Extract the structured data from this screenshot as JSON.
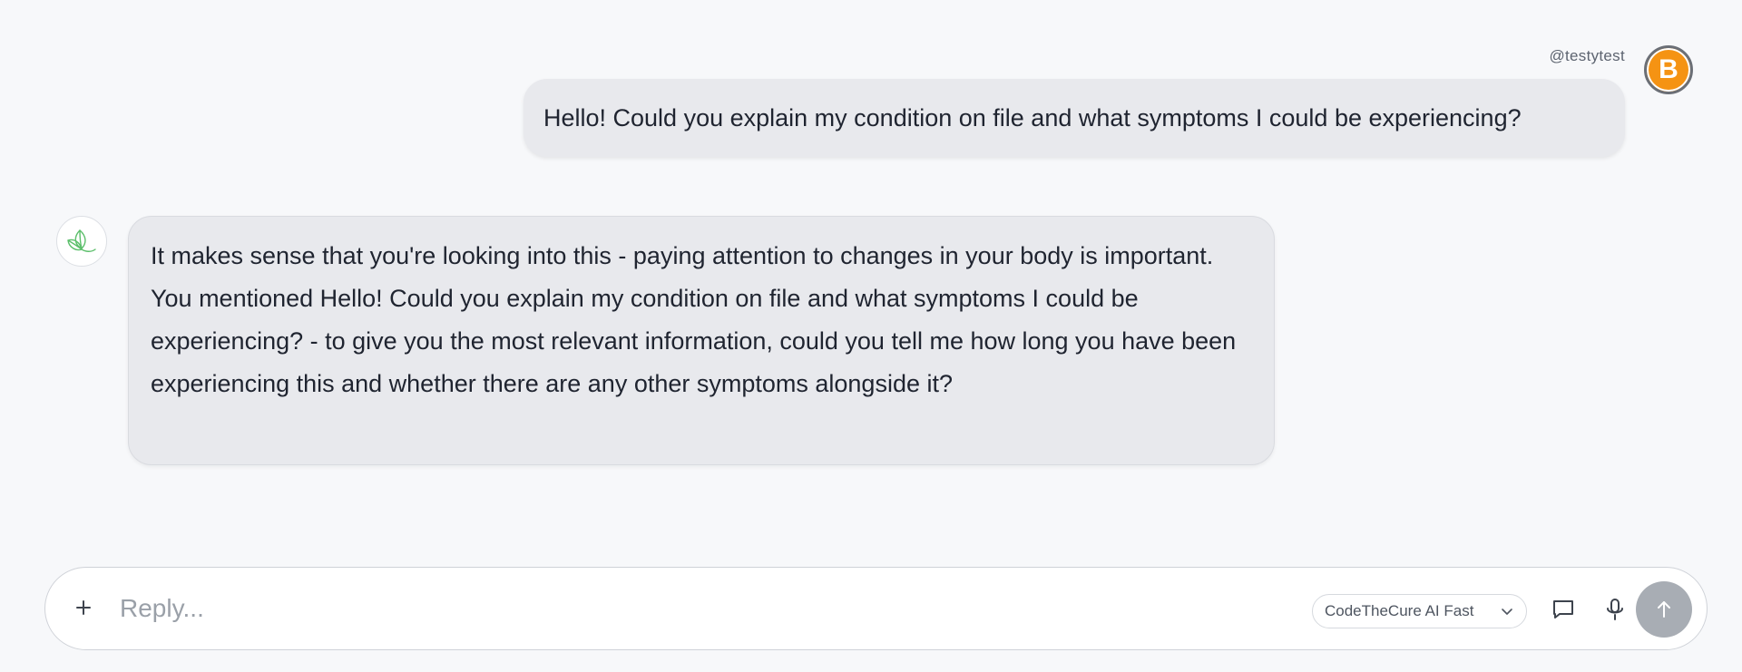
{
  "user": {
    "handle": "@testytest",
    "avatar_initial": "B",
    "avatar_color": "#f59313"
  },
  "messages": [
    {
      "role": "user",
      "text": "Hello! Could you explain my condition on file and what symptoms I could be experiencing?"
    },
    {
      "role": "assistant",
      "avatar_icon": "leaf-logo-icon",
      "text": "It makes sense that you're looking into this - paying attention to changes in your body is important. You mentioned Hello! Could you explain my condition on file and what symptoms I could be experiencing? - to give you the most relevant information, could you tell me how long you have been experiencing this and whether there are any other symptoms alongside it?"
    }
  ],
  "composer": {
    "placeholder": "Reply...",
    "value": "",
    "add_icon": "plus-icon",
    "model_label": "CodeTheCure AI Fast",
    "model_icon": "chevron-down-icon",
    "chat_icon": "chat-bubble-icon",
    "mic_icon": "microphone-icon",
    "send_icon": "arrow-up-icon",
    "send_color": "#a8adb4"
  }
}
